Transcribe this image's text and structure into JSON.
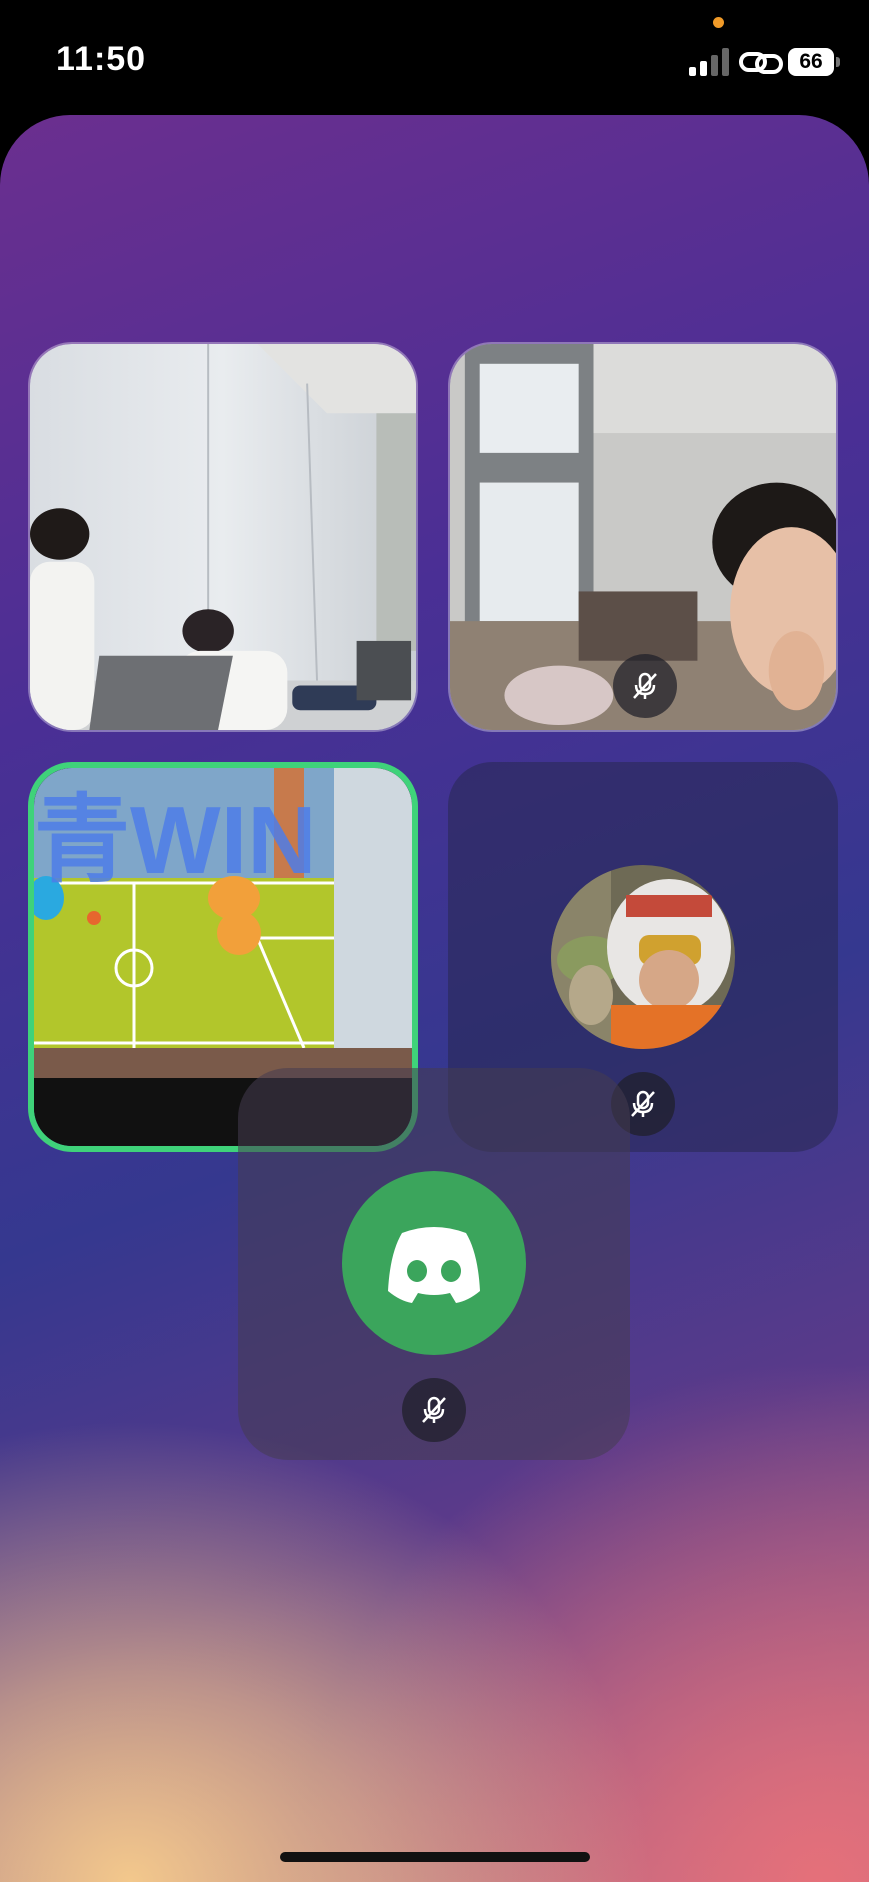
{
  "status_bar": {
    "time": "11:50",
    "battery_level": "66",
    "privacy_indicator_color": "#f09a28",
    "signal_bars_active": 2,
    "signal_bars_total": 4
  },
  "theme": {
    "speaking_border_color": "#3fd27a",
    "discord_avatar_color": "#3ba55c"
  },
  "participants": [
    {
      "tile": "video",
      "content": "camera-video-classroom",
      "muted": false,
      "speaking": false
    },
    {
      "tile": "video",
      "content": "camera-video-child",
      "muted": true,
      "speaking": false
    },
    {
      "tile": "video",
      "content": "screen-share-game",
      "muted": false,
      "speaking": true,
      "screen_text": "青WIN"
    },
    {
      "tile": "audio",
      "content": "avatar-pilot-helmet",
      "muted": true,
      "speaking": false
    },
    {
      "tile": "audio",
      "content": "discord-default-avatar",
      "muted": true,
      "speaking": false
    }
  ],
  "icons": {
    "mute": "mic-off-icon",
    "discord": "discord-logo-icon",
    "link": "link-icon",
    "signal": "cellular-signal-icon",
    "battery": "battery-icon"
  }
}
